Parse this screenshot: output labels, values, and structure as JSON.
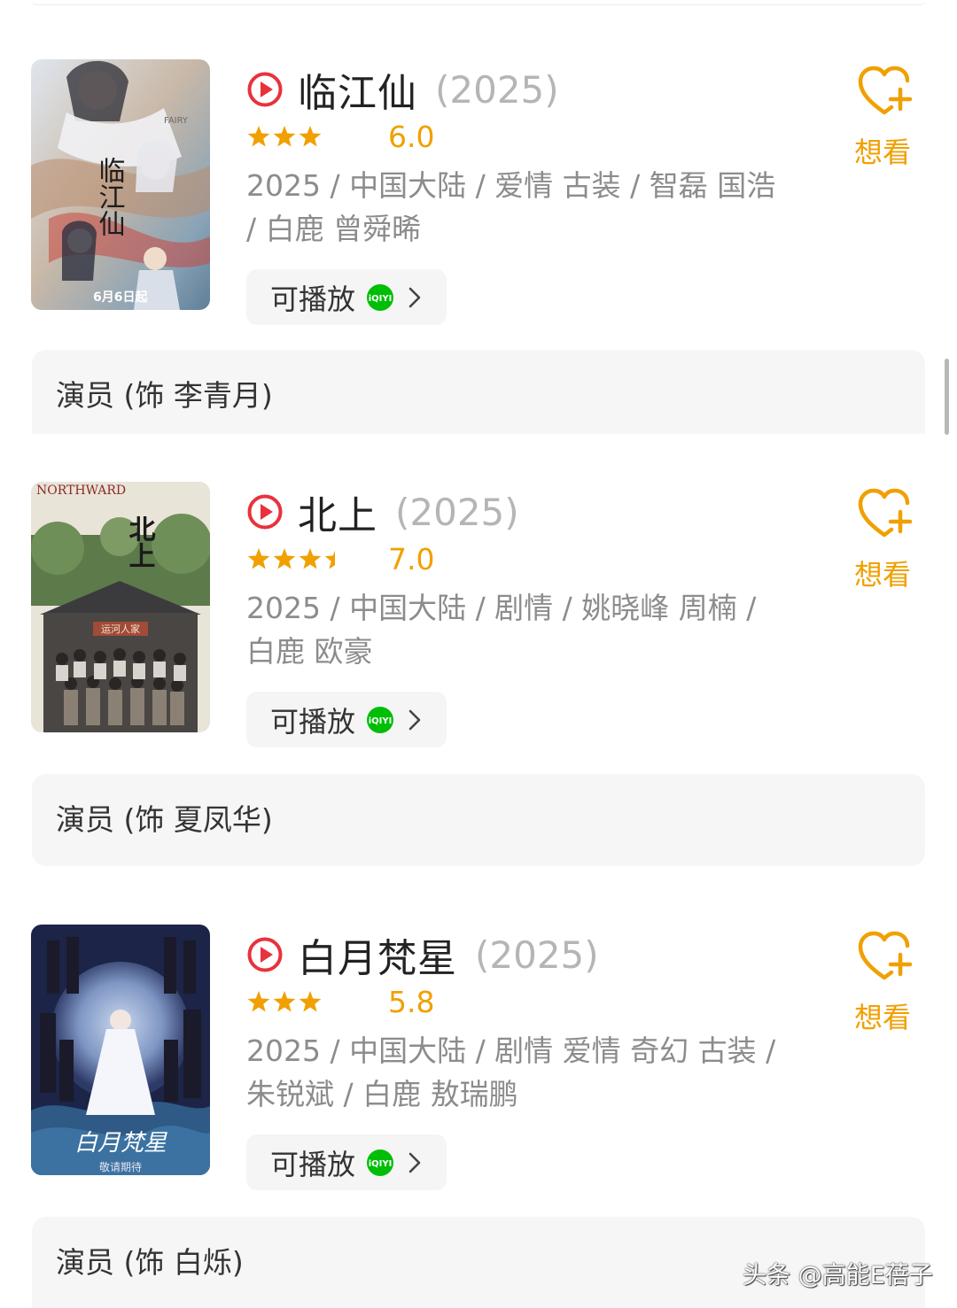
{
  "colors": {
    "accent": "#f0a000",
    "title": "#222222",
    "year": "#b5b5b5",
    "meta": "#8c8c8c",
    "play_red": "#e8323c",
    "iqiyi_green": "#00be06",
    "card_bg": "#f6f6f6"
  },
  "movies": [
    {
      "title": "临江仙",
      "year": "(2025)",
      "rating": 6.0,
      "rating_text": "6.0",
      "stars_filled": 3.0,
      "meta": "2025 / 中国大陆 / 爱情 古装 / 智磊 国浩 / 白鹿 曾舜晞",
      "play_label": "可播放",
      "want_label": "想看",
      "actor_role": "演员 (饰 李青月)",
      "poster": {
        "text_main": "临江仙",
        "text_date": "6月6日起",
        "text_sub": "FAIRY"
      }
    },
    {
      "title": "北上",
      "year": "(2025)",
      "rating": 7.0,
      "rating_text": "7.0",
      "stars_filled": 3.5,
      "meta": "2025 / 中国大陆 / 剧情 / 姚晓峰 周楠 / 白鹿 欧豪",
      "play_label": "可播放",
      "want_label": "想看",
      "actor_role": "演员 (饰 夏凤华)",
      "poster": {
        "text_main": "北上",
        "text_sign": "运河人家",
        "text_top": "NORTHWARD"
      }
    },
    {
      "title": "白月梵星",
      "year": "(2025)",
      "rating": 5.8,
      "rating_text": "5.8",
      "stars_filled": 3.0,
      "meta": "2025 / 中国大陆 / 剧情 爱情 奇幻 古装 / 朱锐斌 / 白鹿 敖瑞鹏",
      "play_label": "可播放",
      "want_label": "想看",
      "actor_role": "演员 (饰 白烁)",
      "poster": {
        "text_main": "白月梵星",
        "text_sub": "敬请期待"
      }
    }
  ],
  "watermark": "头条 @高能E蓓子"
}
